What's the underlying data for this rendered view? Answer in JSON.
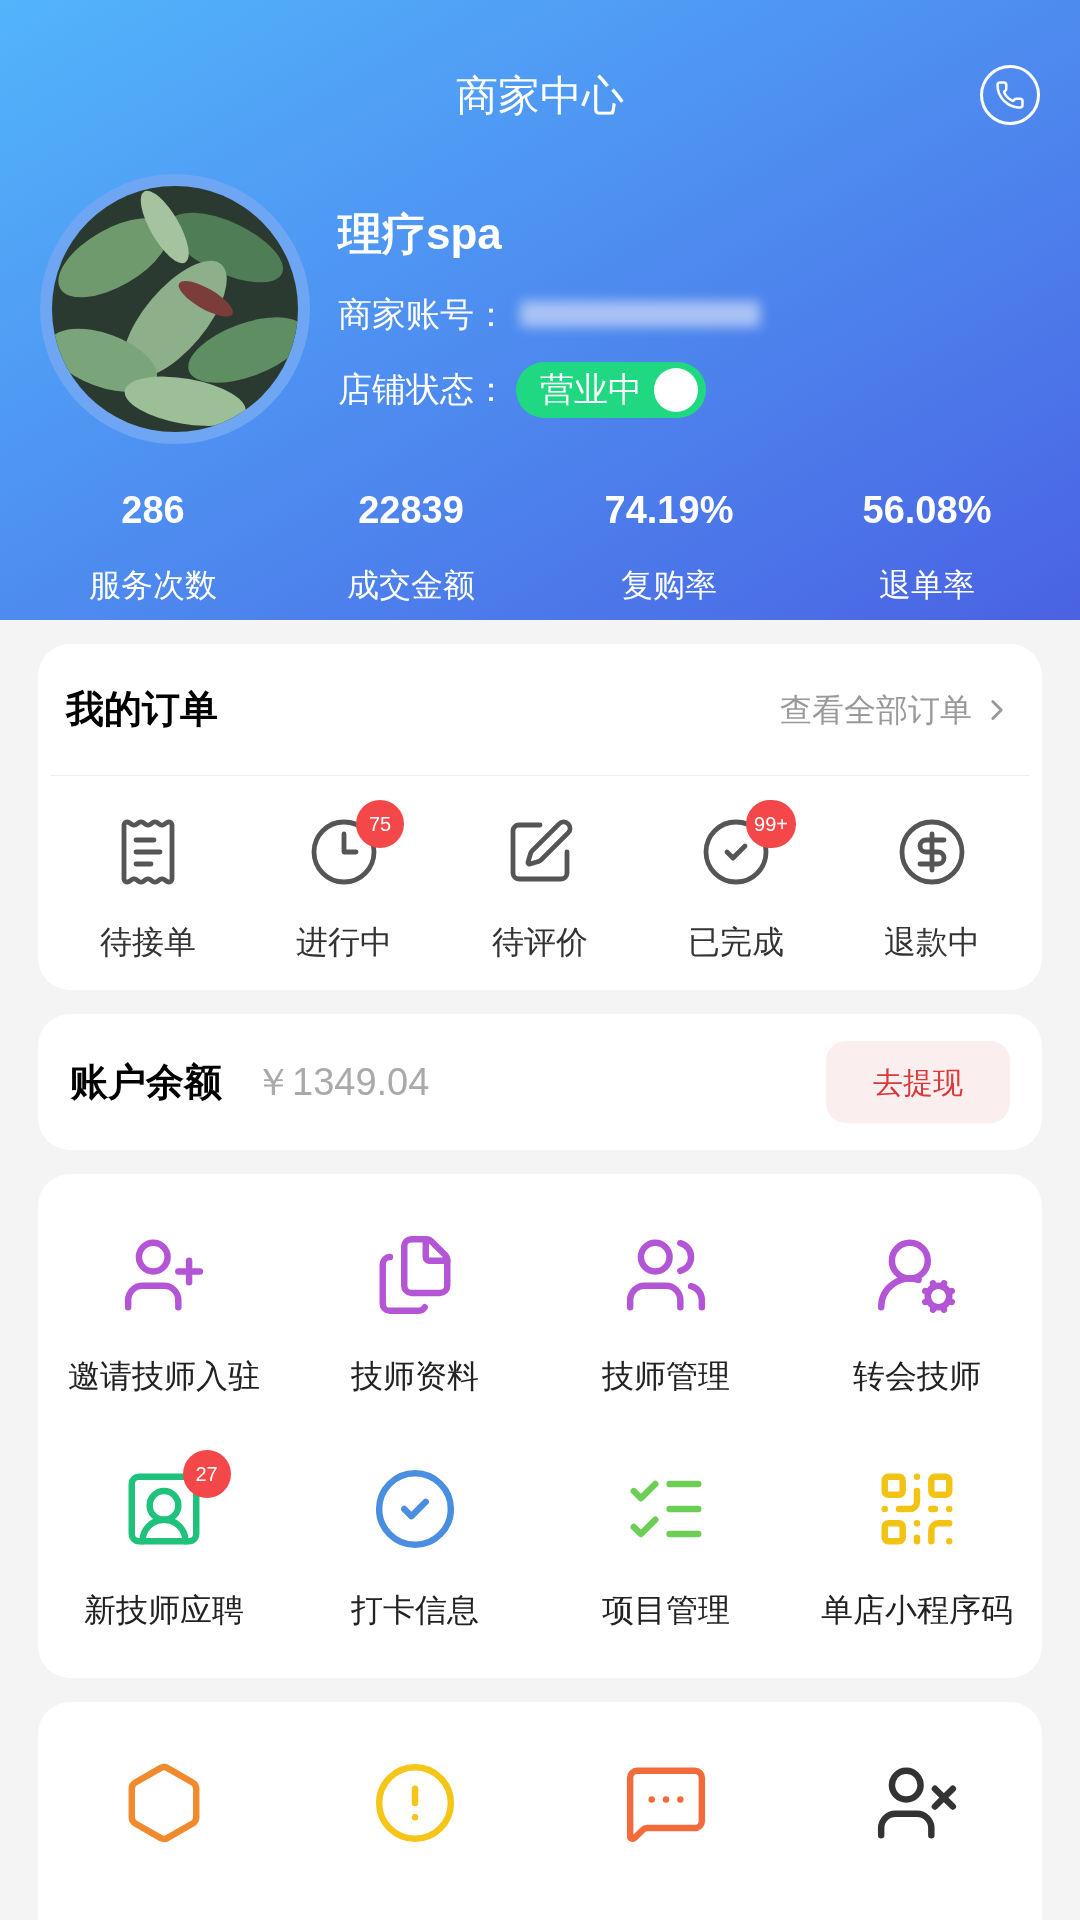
{
  "header": {
    "title": "商家中心",
    "shop_name": "理疗spa",
    "account_label": "商家账号：",
    "status_label": "店铺状态：",
    "status_toggle": {
      "label": "营业中",
      "on": true
    }
  },
  "stats": [
    {
      "value": "286",
      "label": "服务次数"
    },
    {
      "value": "22839",
      "label": "成交金额"
    },
    {
      "value": "74.19%",
      "label": "复购率"
    },
    {
      "value": "56.08%",
      "label": "退单率"
    }
  ],
  "orders": {
    "title": "我的订单",
    "view_all": "查看全部订单",
    "items": [
      {
        "kind": "pending",
        "label": "待接单"
      },
      {
        "kind": "ongoing",
        "label": "进行中",
        "badge": "75"
      },
      {
        "kind": "review",
        "label": "待评价"
      },
      {
        "kind": "done",
        "label": "已完成",
        "badge": "99+"
      },
      {
        "kind": "refund",
        "label": "退款中"
      }
    ]
  },
  "balance": {
    "title": "账户余额",
    "amount": "￥1349.04",
    "button": "去提现"
  },
  "tools": [
    {
      "kind": "invite",
      "label": "邀请技师入驻"
    },
    {
      "kind": "profile",
      "label": "技师资料"
    },
    {
      "kind": "manage",
      "label": "技师管理"
    },
    {
      "kind": "transfer",
      "label": "转会技师"
    },
    {
      "kind": "apply",
      "label": "新技师应聘",
      "badge": "27"
    },
    {
      "kind": "checkin",
      "label": "打卡信息"
    },
    {
      "kind": "project",
      "label": "项目管理"
    },
    {
      "kind": "qrcode",
      "label": "单店小程序码"
    }
  ],
  "more_tools": [
    {
      "kind": "refund"
    },
    {
      "kind": "complaint"
    },
    {
      "kind": "comment"
    },
    {
      "kind": "blocked"
    }
  ]
}
